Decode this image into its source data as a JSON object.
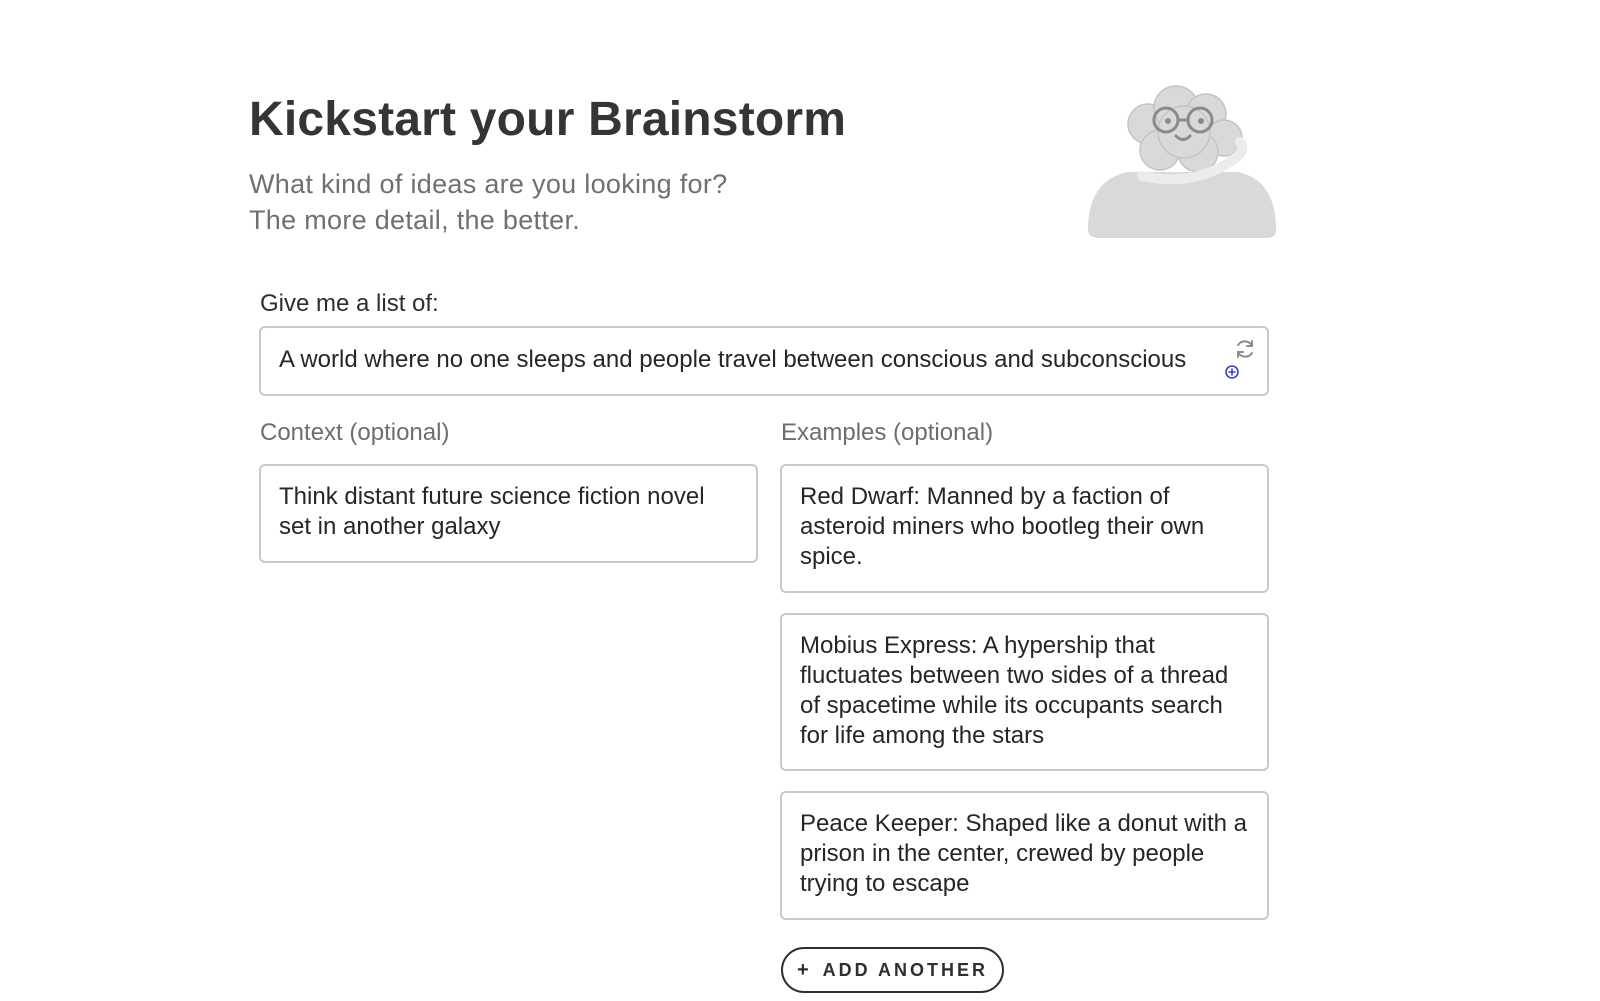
{
  "header": {
    "title": "Kickstart your Brainstorm",
    "subtitle_line1": "What kind of ideas are you looking for?",
    "subtitle_line2": "The more detail, the better."
  },
  "main_prompt": {
    "label": "Give me a list of:",
    "value": "A world where no one sleeps and people travel between conscious and subconscious",
    "icons": [
      "refresh-icon",
      "add-circle-icon"
    ]
  },
  "context": {
    "label": "Context (optional)",
    "value": "Think distant future science fiction novel set in another galaxy"
  },
  "examples": {
    "label": "Examples (optional)",
    "items": [
      "Red Dwarf: Manned by a faction of asteroid miners who bootleg their own spice.",
      "Mobius Express: A hypership that fluctuates between two sides of a thread of spacetime while its occupants search for life among the stars",
      "Peace Keeper: Shaped like a donut with a prison in the center, crewed by people trying to escape"
    ],
    "add_button": {
      "icon": "+",
      "label": "ADD ANOTHER"
    }
  },
  "colors": {
    "title": "#353535",
    "subtitle": "#707070",
    "border": "#c9c9c9",
    "accent_dot": "#3a3fd6",
    "mascot": "#d9d9d9"
  }
}
